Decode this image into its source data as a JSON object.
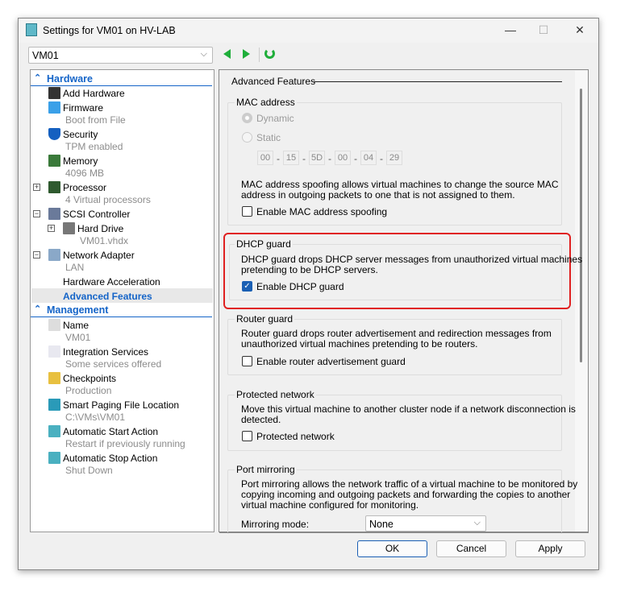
{
  "window": {
    "title": "Settings for VM01 on HV-LAB",
    "minimize": "—",
    "maximize": "☐",
    "close": "✕"
  },
  "vm_selector": {
    "value": "VM01"
  },
  "tree": {
    "hardware_header": "Hardware",
    "management_header": "Management",
    "items": [
      {
        "label": "Add Hardware",
        "icon": "add-hardware-icon"
      },
      {
        "label": "Firmware",
        "sub": "Boot from File",
        "icon": "firmware-icon"
      },
      {
        "label": "Security",
        "sub": "TPM enabled",
        "icon": "shield-icon"
      },
      {
        "label": "Memory",
        "sub": "4096 MB",
        "icon": "memory-icon"
      },
      {
        "label": "Processor",
        "sub": "4 Virtual processors",
        "icon": "processor-icon",
        "expander": "+"
      },
      {
        "label": "SCSI Controller",
        "icon": "scsi-controller-icon",
        "expander": "−"
      },
      {
        "label": "Hard Drive",
        "sub": "VM01.vhdx",
        "icon": "hard-drive-icon",
        "expander": "+"
      },
      {
        "label": "Network Adapter",
        "sub": "LAN",
        "icon": "network-adapter-icon",
        "expander": "−"
      },
      {
        "label": "Hardware Acceleration"
      },
      {
        "label": "Advanced Features",
        "selected": true
      },
      {
        "label": "Name",
        "sub": "VM01",
        "icon": "name-icon"
      },
      {
        "label": "Integration Services",
        "sub": "Some services offered",
        "icon": "integration-services-icon"
      },
      {
        "label": "Checkpoints",
        "sub": "Production",
        "icon": "checkpoints-icon"
      },
      {
        "label": "Smart Paging File Location",
        "sub": "C:\\VMs\\VM01",
        "icon": "smart-paging-icon"
      },
      {
        "label": "Automatic Start Action",
        "sub": "Restart if previously running",
        "icon": "start-action-icon"
      },
      {
        "label": "Automatic Stop Action",
        "sub": "Shut Down",
        "icon": "stop-action-icon"
      }
    ]
  },
  "main": {
    "section_title": "Advanced Features",
    "mac": {
      "title": "MAC address",
      "dynamic": "Dynamic",
      "static": "Static",
      "octets": [
        "00",
        "15",
        "5D",
        "00",
        "04",
        "29"
      ],
      "desc1": "MAC address spoofing allows virtual machines to change the source MAC",
      "desc2": "address in outgoing packets to one that is not assigned to them.",
      "checkbox": "Enable MAC address spoofing"
    },
    "dhcp": {
      "title": "DHCP guard",
      "desc1": "DHCP guard drops DHCP server messages from unauthorized virtual machines",
      "desc2": "pretending to be DHCP servers.",
      "checkbox": "Enable DHCP guard",
      "checked": true
    },
    "router": {
      "title": "Router guard",
      "desc1": "Router guard drops router advertisement and redirection messages from",
      "desc2": "unauthorized virtual machines pretending to be routers.",
      "checkbox": "Enable router advertisement guard"
    },
    "protected": {
      "title": "Protected network",
      "desc1": "Move this virtual machine to another cluster node if a network disconnection is",
      "desc2": "detected.",
      "checkbox": "Protected network"
    },
    "mirroring": {
      "title": "Port mirroring",
      "desc1": "Port mirroring allows the network traffic of a virtual machine to be monitored by",
      "desc2": "copying incoming and outgoing packets and forwarding the copies to another",
      "desc3": "virtual machine configured for monitoring.",
      "mode_label": "Mirroring mode:",
      "mode_value": "None"
    }
  },
  "buttons": {
    "ok": "OK",
    "cancel": "Cancel",
    "apply": "Apply"
  },
  "colors": {
    "highlight": "#e02020",
    "accent": "#1464c8"
  }
}
